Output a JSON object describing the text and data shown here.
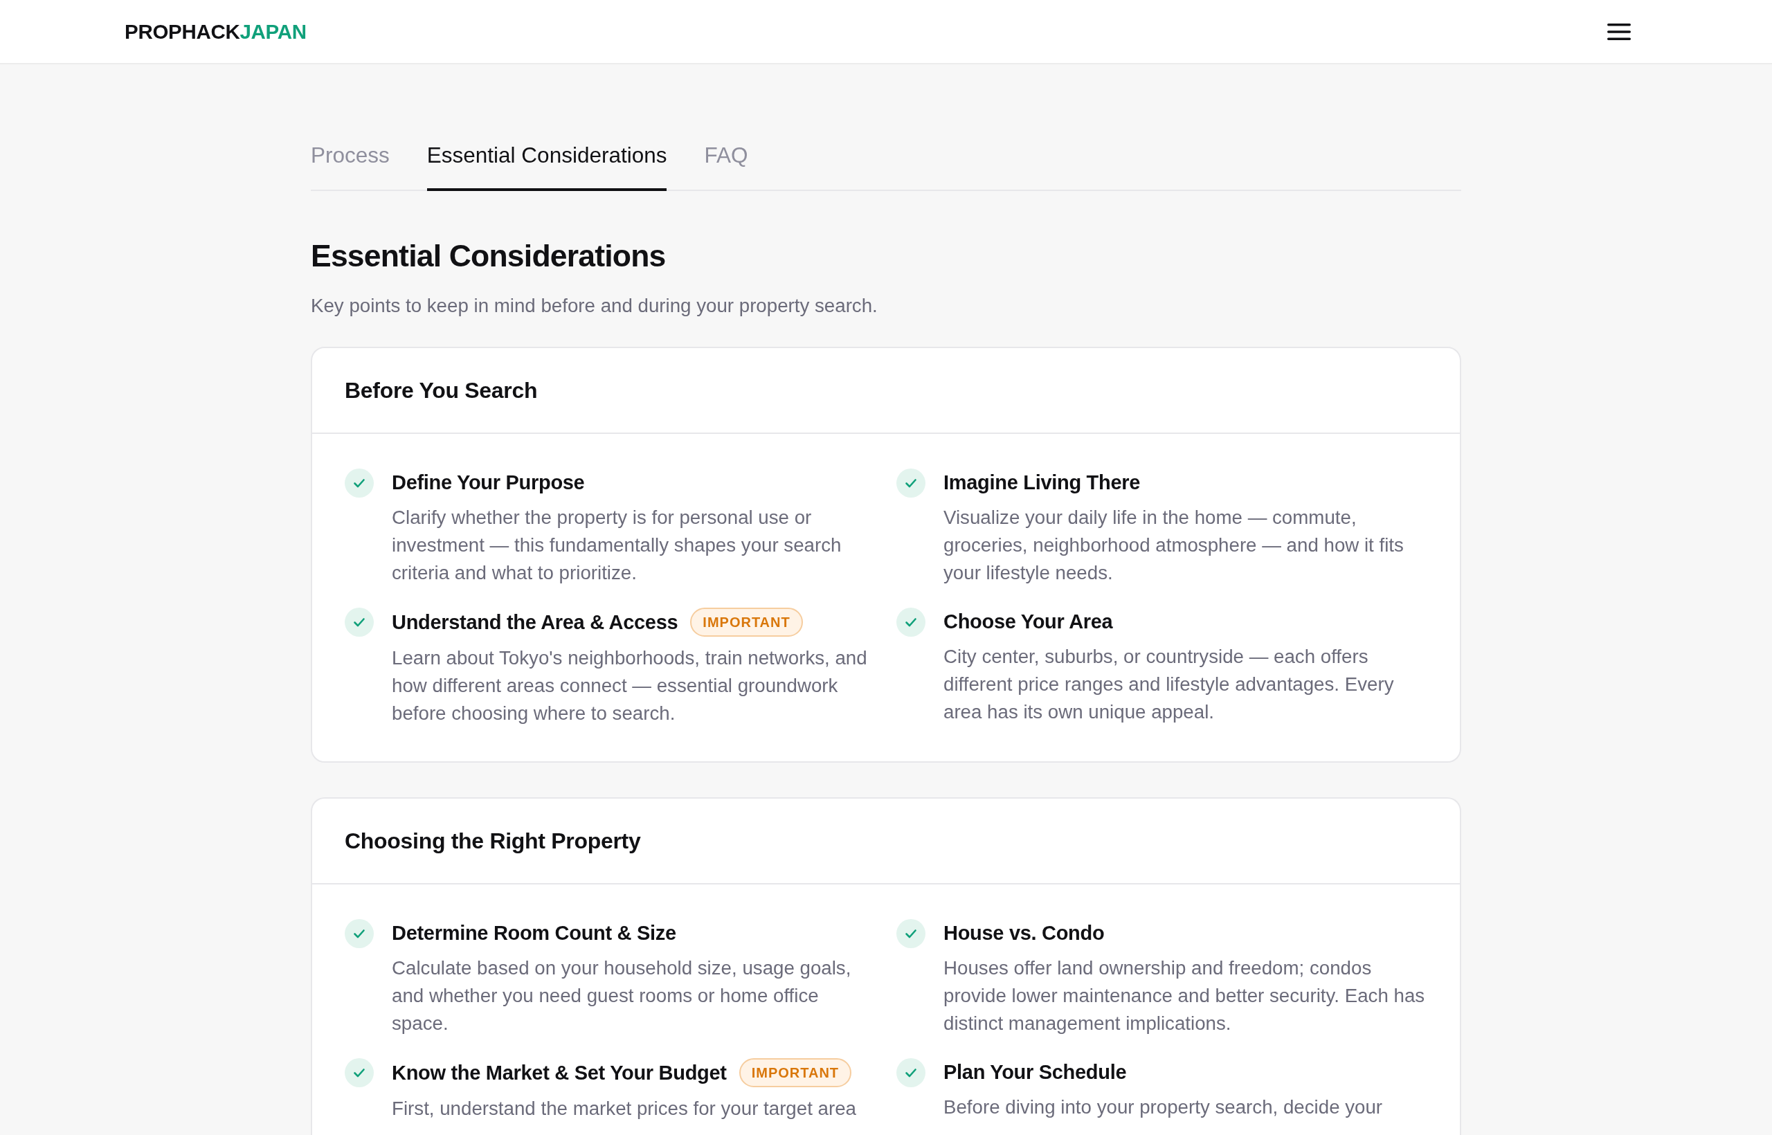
{
  "header": {
    "logo": {
      "primary": "PROPHACK",
      "accent": "JAPAN"
    }
  },
  "tabs": [
    {
      "label": "Process",
      "selected": false
    },
    {
      "label": "Essential Considerations",
      "selected": true
    },
    {
      "label": "FAQ",
      "selected": false
    }
  ],
  "page_title": "Essential Considerations",
  "page_subtitle": "Key points to keep in mind before and during your property search.",
  "sections": [
    {
      "title": "Before You Search",
      "items": [
        {
          "title": "Define Your Purpose",
          "description": "Clarify whether the property is for personal use or investment — this fundamentally shapes your search criteria and what to prioritize."
        },
        {
          "title": "Imagine Living There",
          "description": "Visualize your daily life in the home — commute, groceries, neighborhood atmosphere — and how it fits your lifestyle needs."
        },
        {
          "title": "Understand the Area & Access",
          "badge": "IMPORTANT",
          "description": "Learn about Tokyo's neighborhoods, train networks, and how different areas connect — essential groundwork before choosing where to search."
        },
        {
          "title": "Choose Your Area",
          "description": "City center, suburbs, or countryside — each offers different price ranges and lifestyle advantages. Every area has its own unique appeal."
        }
      ]
    },
    {
      "title": "Choosing the Right Property",
      "items": [
        {
          "title": "Determine Room Count & Size",
          "description": "Calculate based on your household size, usage goals, and whether you need guest rooms or home office space."
        },
        {
          "title": "House vs. Condo",
          "description": "Houses offer land ownership and freedom; condos provide lower maintenance and better security. Each has distinct management implications."
        },
        {
          "title": "Know the Market & Set Your Budget",
          "badge": "IMPORTANT",
          "description": "First, understand the market prices for your target area"
        },
        {
          "title": "Plan Your Schedule",
          "description": "Before diving into your property search, decide your"
        }
      ]
    }
  ]
}
